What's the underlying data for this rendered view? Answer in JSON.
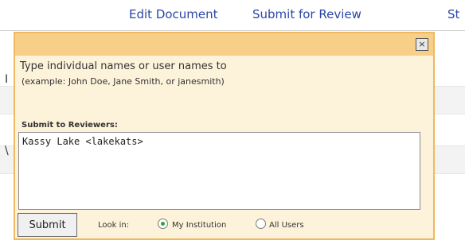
{
  "nav": {
    "edit": "Edit Document",
    "submit": "Submit for Review",
    "more": "St"
  },
  "background": {
    "letter1": "I",
    "letter2": "\\"
  },
  "popup": {
    "close": "×",
    "instruction": "Type individual names or user names to",
    "example": "(example: John Doe, Jane Smith, or janesmith)",
    "reviewers_label": "Submit to Reviewers:",
    "reviewers_value": "Kassy Lake <lakekats>",
    "submit_label": "Submit",
    "look_in_label": "Look in:",
    "options": [
      {
        "label": "My Institution",
        "selected": true
      },
      {
        "label": "All Users",
        "selected": false
      }
    ]
  }
}
